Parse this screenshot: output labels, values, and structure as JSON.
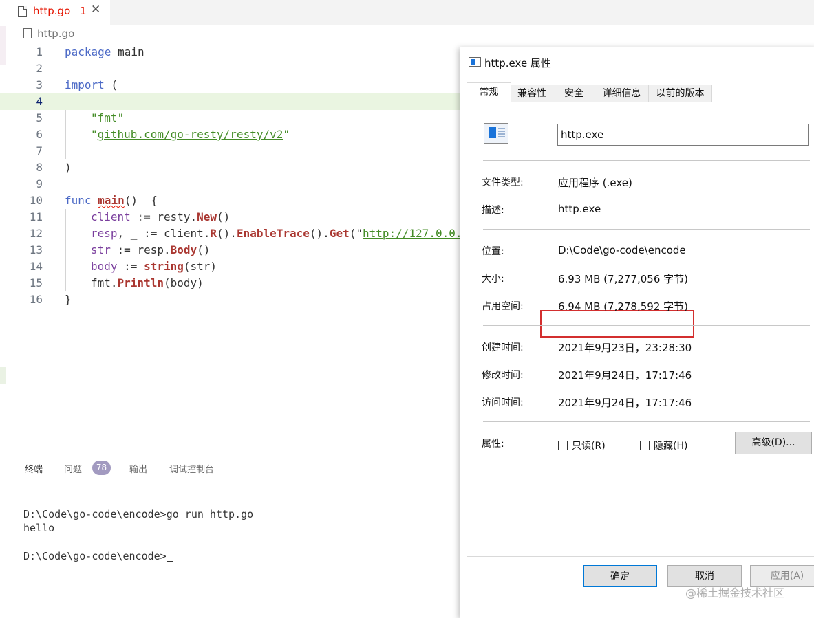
{
  "editor": {
    "tab": {
      "name": "http.go",
      "problems": "1",
      "close": "✕"
    },
    "breadcrumb": "http.go",
    "lines": [
      {
        "n": "1"
      },
      {
        "n": "2"
      },
      {
        "n": "3"
      },
      {
        "n": "4"
      },
      {
        "n": "5"
      },
      {
        "n": "6"
      },
      {
        "n": "7"
      },
      {
        "n": "8"
      },
      {
        "n": "9"
      },
      {
        "n": "10"
      },
      {
        "n": "11"
      },
      {
        "n": "12"
      },
      {
        "n": "13"
      },
      {
        "n": "14"
      },
      {
        "n": "15"
      },
      {
        "n": "16"
      }
    ],
    "code": {
      "l1_kw": "package",
      "l1_rest": " main",
      "l3_kw": "import",
      "l3_rest": " (",
      "l5": "\"fmt\"",
      "l6_q1": "\"",
      "l6_path": "github.com/go-resty/resty/v2",
      "l6_q2": "\"",
      "l8": ")",
      "l10_kw": "func ",
      "l10_name": "main",
      "l10_rest": "()  {",
      "l11_var": "client",
      "l11_op": " := ",
      "l11_pkg": "resty.",
      "l11_fn": "New",
      "l11_end": "()",
      "l12_var": "resp",
      "l12_mid": ", _ := client.",
      "l12_fn1": "R",
      "l12_p1": "().",
      "l12_fn2": "EnableTrace",
      "l12_p2": "().",
      "l12_fn3": "Get",
      "l12_p3": "(\"",
      "l12_url": "http://127.0.0.",
      "l13_var": "str",
      "l13_mid": " := resp.",
      "l13_fn": "Body",
      "l13_end": "()",
      "l14_var": "body",
      "l14_mid": " := ",
      "l14_fn": "string",
      "l14_end": "(str)",
      "l15_pre": "fmt.",
      "l15_fn": "Println",
      "l15_end": "(body)",
      "l16": "}"
    }
  },
  "panel": {
    "tabs": [
      "终端",
      "问题",
      "输出",
      "调试控制台"
    ],
    "problems_badge": "78",
    "terminal": [
      "D:\\Code\\go-code\\encode>go run http.go",
      "hello",
      "D:\\Code\\go-code\\encode>"
    ]
  },
  "dialog": {
    "title": "http.exe 属性",
    "tabs": [
      "常规",
      "兼容性",
      "安全",
      "详细信息",
      "以前的版本"
    ],
    "filename": "http.exe",
    "props": [
      {
        "label": "文件类型:",
        "value": "应用程序 (.exe)"
      },
      {
        "label": "描述:",
        "value": "http.exe"
      },
      {
        "label": "位置:",
        "value": "D:\\Code\\go-code\\encode"
      },
      {
        "label": "大小:",
        "value": "6.93 MB (7,277,056 字节)"
      },
      {
        "label": "占用空间:",
        "value": "6.94 MB (7,278,592 字节)"
      },
      {
        "label": "创建时间:",
        "value": "2021年9月23日，23:28:30"
      },
      {
        "label": "修改时间:",
        "value": "2021年9月24日，17:17:46"
      },
      {
        "label": "访问时间:",
        "value": "2021年9月24日，17:17:46"
      }
    ],
    "attributes_label": "属性:",
    "readonly_label": "只读(R)",
    "hidden_label": "隐藏(H)",
    "advanced_label": "高级(D)...",
    "ok_label": "确定",
    "cancel_label": "取消",
    "apply_label": "应用(A)"
  },
  "watermark": "@稀土掘金技术社区"
}
